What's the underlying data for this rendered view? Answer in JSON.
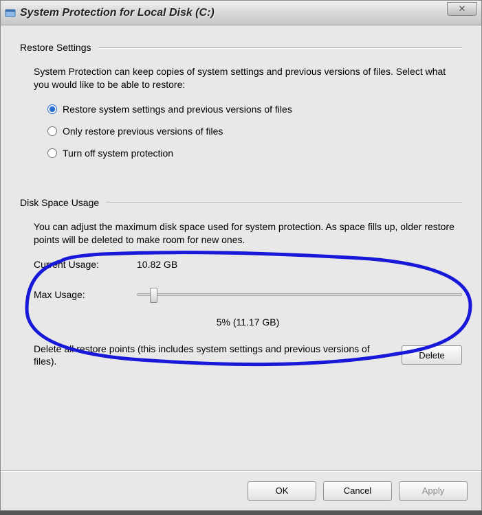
{
  "window": {
    "title": "System Protection for Local Disk (C:)",
    "close_glyph": "✕"
  },
  "restore": {
    "header": "Restore Settings",
    "description": "System Protection can keep copies of system settings and previous versions of files. Select what you would like to be able to restore:",
    "options": [
      {
        "label": "Restore system settings and previous versions of files",
        "selected": true
      },
      {
        "label": "Only restore previous versions of files",
        "selected": false
      },
      {
        "label": "Turn off system protection",
        "selected": false
      }
    ]
  },
  "disk": {
    "header": "Disk Space Usage",
    "description": "You can adjust the maximum disk space used for system protection. As space fills up, older restore points will be deleted to make room for new ones.",
    "current_label": "Current Usage:",
    "current_value": "10.82 GB",
    "max_label": "Max Usage:",
    "max_value": "5% (11.17 GB)",
    "slider_percent": 5
  },
  "delete": {
    "text": "Delete all restore points (this includes system settings and previous versions of files).",
    "button": "Delete"
  },
  "footer": {
    "ok": "OK",
    "cancel": "Cancel",
    "apply": "Apply"
  }
}
